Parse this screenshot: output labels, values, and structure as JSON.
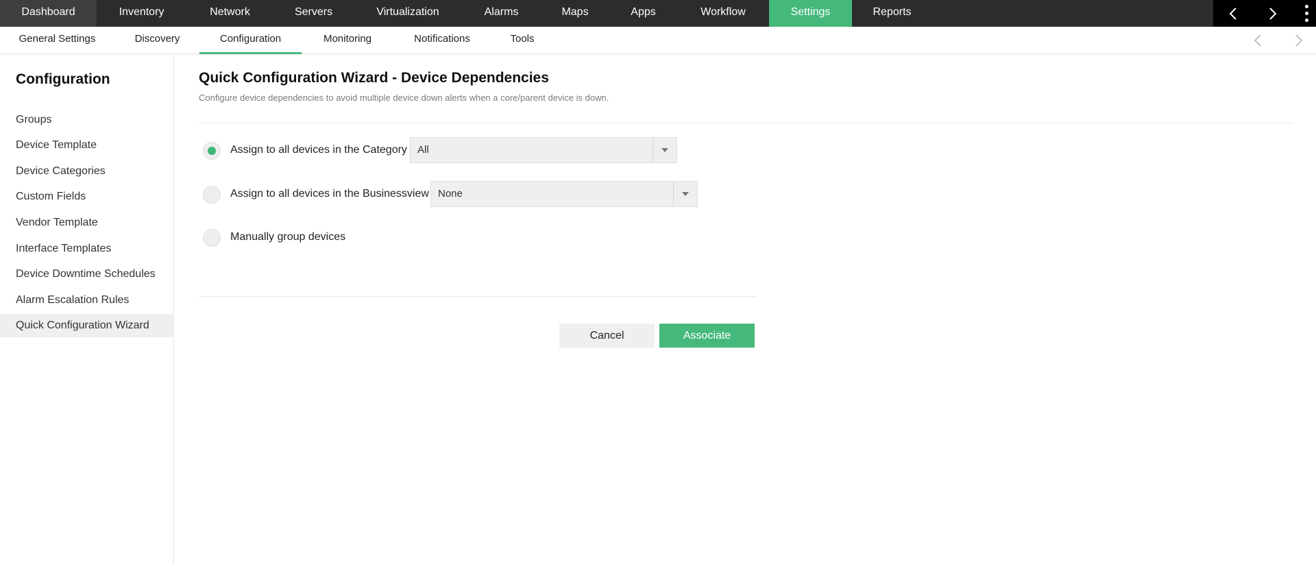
{
  "topnav": {
    "items": [
      {
        "label": "Dashboard"
      },
      {
        "label": "Inventory"
      },
      {
        "label": "Network"
      },
      {
        "label": "Servers"
      },
      {
        "label": "Virtualization"
      },
      {
        "label": "Alarms"
      },
      {
        "label": "Maps"
      },
      {
        "label": "Apps"
      },
      {
        "label": "Workflow"
      },
      {
        "label": "Settings"
      },
      {
        "label": "Reports"
      }
    ],
    "active": "Settings"
  },
  "subnav": {
    "items": [
      {
        "label": "General Settings"
      },
      {
        "label": "Discovery"
      },
      {
        "label": "Configuration"
      },
      {
        "label": "Monitoring"
      },
      {
        "label": "Notifications"
      },
      {
        "label": "Tools"
      }
    ],
    "active": "Configuration"
  },
  "sidebar": {
    "title": "Configuration",
    "items": [
      {
        "label": "Groups"
      },
      {
        "label": "Device Template"
      },
      {
        "label": "Device Categories"
      },
      {
        "label": "Custom Fields"
      },
      {
        "label": "Vendor Template"
      },
      {
        "label": "Interface Templates"
      },
      {
        "label": "Device Downtime Schedules"
      },
      {
        "label": "Alarm Escalation Rules"
      },
      {
        "label": "Quick Configuration Wizard"
      }
    ],
    "active": "Quick Configuration Wizard"
  },
  "main": {
    "title": "Quick Configuration Wizard - Device Dependencies",
    "description": "Configure device dependencies to avoid multiple device down alerts when a core/parent device is down.",
    "options": [
      {
        "label": "Assign to all devices in the Category",
        "selected": true,
        "select_value": "All"
      },
      {
        "label": "Assign to all devices in the Businessview",
        "selected": false,
        "select_value": "None"
      },
      {
        "label": "Manually group devices",
        "selected": false
      }
    ],
    "cancel_label": "Cancel",
    "associate_label": "Associate"
  },
  "colors": {
    "accent": "#45b97c",
    "topnav_bg": "#2c2c2c"
  }
}
